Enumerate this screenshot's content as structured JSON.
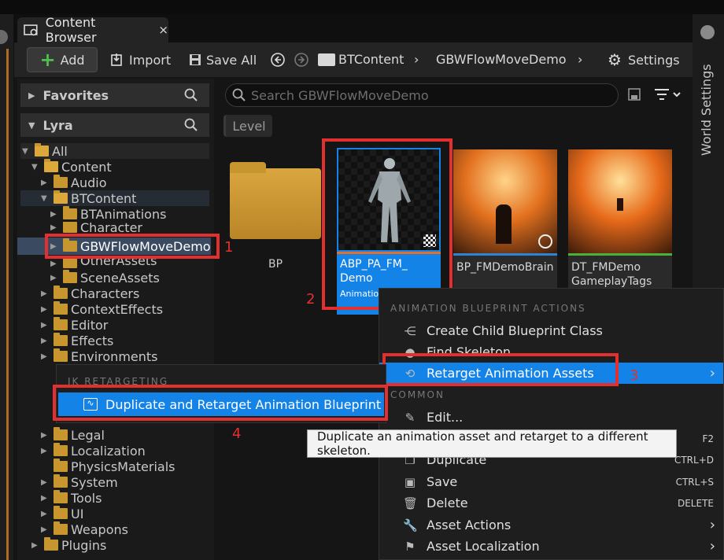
{
  "tab": {
    "title": "Content Browser",
    "close": "×"
  },
  "toolbar": {
    "add": "Add",
    "import": "Import",
    "save_all": "Save All",
    "settings": "Settings"
  },
  "breadcrumb": [
    "BTContent",
    "GBWFlowMoveDemo"
  ],
  "side_tab": {
    "label": "World Settings"
  },
  "left": {
    "favorites": "Favorites",
    "project": "Lyra",
    "tree": [
      {
        "label": "All"
      },
      {
        "label": "Content"
      },
      {
        "label": "Audio"
      },
      {
        "label": "BTContent"
      },
      {
        "label": "BTAnimations"
      },
      {
        "label": "Character"
      },
      {
        "label": "GBWFlowMoveDemo"
      },
      {
        "label": "OtherAssets"
      },
      {
        "label": "SceneAssets"
      },
      {
        "label": "Characters"
      },
      {
        "label": "ContextEffects"
      },
      {
        "label": "Editor"
      },
      {
        "label": "Effects"
      },
      {
        "label": "Environments"
      },
      {
        "label": "Legal"
      },
      {
        "label": "Localization"
      },
      {
        "label": "PhysicsMaterials"
      },
      {
        "label": "System"
      },
      {
        "label": "Tools"
      },
      {
        "label": "UI"
      },
      {
        "label": "Weapons"
      },
      {
        "label": "Plugins"
      }
    ]
  },
  "search": {
    "placeholder": "Search GBWFlowMoveDemo"
  },
  "filter_chip": "Level",
  "assets": [
    {
      "name": "BP"
    },
    {
      "name": "ABP_PA_FM_\nDemo",
      "type_short": "Animatio"
    },
    {
      "name": "BP_FMDemoBrain"
    },
    {
      "name": "DT_FMDemo\nGameplayTags"
    }
  ],
  "context_menu": {
    "header_anim": "ANIMATION BLUEPRINT ACTIONS",
    "create_child": "Create Child Blueprint Class",
    "find_skeleton": "Find Skeleton",
    "retarget": "Retarget Animation Assets",
    "header_common": "COMMON",
    "edit": "Edit...",
    "rename_sc": "F2",
    "duplicate": "Duplicate",
    "duplicate_sc": "CTRL+D",
    "save": "Save",
    "save_sc": "CTRL+S",
    "delete": "Delete",
    "delete_sc": "DELETE",
    "asset_actions": "Asset Actions",
    "asset_localization": "Asset Localization"
  },
  "submenu": {
    "header": "IK RETARGETING",
    "item": "Duplicate and Retarget Animation Blueprint"
  },
  "tooltip": "Duplicate an animation asset and retarget to a different skeleton.",
  "annotations": [
    "1",
    "2",
    "3",
    "4"
  ],
  "colors": {
    "accent": "#1483e8",
    "annotation": "#e23030",
    "folder": "#c8962f"
  }
}
